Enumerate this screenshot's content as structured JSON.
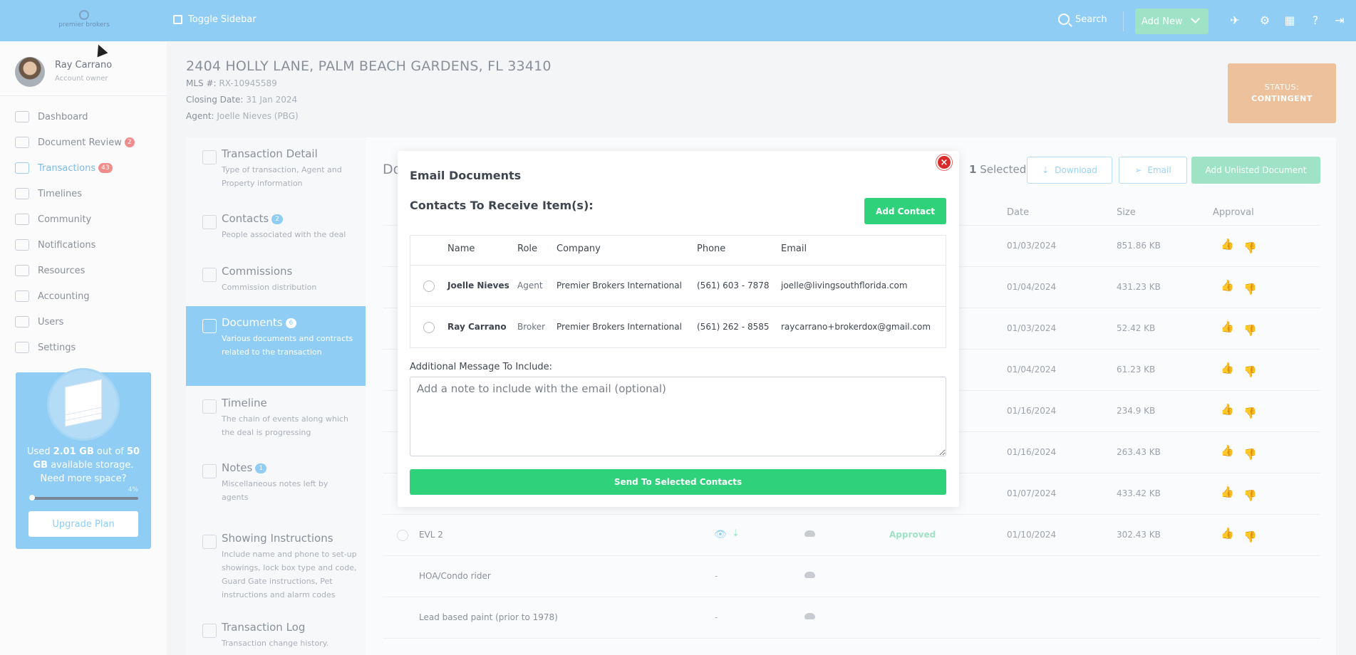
{
  "topbar": {
    "logo_text": "premier brokers",
    "toggle_label": "Toggle Sidebar",
    "search_label": "Search",
    "add_new_label": "Add New"
  },
  "user": {
    "name": "Ray Carrano",
    "role": "Account owner"
  },
  "sidebar": {
    "items": [
      {
        "label": "Dashboard",
        "icon": "dashboard-icon"
      },
      {
        "label": "Document Review",
        "badge": "2",
        "icon": "document-review-icon"
      },
      {
        "label": "Transactions",
        "badge": "43",
        "icon": "transactions-icon",
        "active": true
      },
      {
        "label": "Timelines",
        "icon": "timelines-icon"
      },
      {
        "label": "Community",
        "icon": "community-icon"
      },
      {
        "label": "Notifications",
        "icon": "notifications-icon"
      },
      {
        "label": "Resources",
        "icon": "resources-icon"
      },
      {
        "label": "Accounting",
        "icon": "accounting-icon"
      },
      {
        "label": "Users",
        "icon": "users-icon"
      },
      {
        "label": "Settings",
        "icon": "settings-icon"
      }
    ]
  },
  "storage": {
    "used_prefix": "Used ",
    "used": "2.01 GB",
    "mid": " out of ",
    "total": "50 GB",
    "suffix": " available storage.",
    "question": "Need more space?",
    "percent_label": "4%",
    "percent_value": 4,
    "upgrade_label": "Upgrade Plan"
  },
  "transaction": {
    "address": "2404 HOLLY LANE, PALM BEACH GARDENS, FL 33410",
    "mls_label": "MLS #:",
    "mls": "RX-10945589",
    "closing_label": "Closing Date:",
    "closing": "31 Jan 2024",
    "agent_label": "Agent:",
    "agent": "Joelle Nieves (PBG)",
    "status_label": "STATUS:",
    "status": "CONTINGENT"
  },
  "tabs": [
    {
      "title": "Transaction Detail",
      "desc": "Type of transaction, Agent and Property information"
    },
    {
      "title": "Contacts",
      "badge": "2",
      "desc": "People associated with the deal"
    },
    {
      "title": "Commissions",
      "desc": "Commission distribution"
    },
    {
      "title": "Documents",
      "badge": "6",
      "desc": "Various documents and contracts related to the transaction"
    },
    {
      "title": "Timeline",
      "desc": "The chain of events along which the deal is progressing"
    },
    {
      "title": "Notes",
      "badge": "1",
      "desc": "Miscellaneous notes left by agents"
    },
    {
      "title": "Showing Instructions",
      "desc": "Include name and phone to set-up showings, lock box type and code, Guard Gate instructions, Pet instructions and alarm codes"
    },
    {
      "title": "Transaction Log",
      "desc": "Transaction change history."
    }
  ],
  "documents": {
    "title_partial": "Do",
    "selected_count": "1",
    "selected_label": "Selected",
    "download_label": "Download",
    "email_label": "Email",
    "add_unlisted_label": "Add Unlisted Document",
    "columns": {
      "date": "Date",
      "size": "Size",
      "approval": "Approval"
    },
    "rows": [
      {
        "date": "01/03/2024",
        "size": "851.86 KB"
      },
      {
        "date": "01/04/2024",
        "size": "431.23 KB"
      },
      {
        "date": "01/03/2024",
        "size": "52.42 KB"
      },
      {
        "date": "01/04/2024",
        "size": "61.23 KB"
      },
      {
        "date": "01/16/2024",
        "size": "234.9 KB"
      },
      {
        "date": "01/16/2024",
        "size": "263.43 KB"
      },
      {
        "date": "01/07/2024",
        "size": "433.42 KB"
      },
      {
        "name": "EVL 2",
        "status": "Approved",
        "date": "01/10/2024",
        "size": "302.43 KB"
      },
      {
        "name": "HOA/Condo rider",
        "dash": "-"
      },
      {
        "name": "Lead based paint (prior to 1978)",
        "dash": "-"
      }
    ]
  },
  "modal": {
    "title": "Email Documents",
    "subtitle": "Contacts To Receive Item(s):",
    "add_contact_label": "Add Contact",
    "columns": {
      "name": "Name",
      "role": "Role",
      "company": "Company",
      "phone": "Phone",
      "email": "Email"
    },
    "contacts": [
      {
        "name": "Joelle Nieves",
        "role": "Agent",
        "company": "Premier Brokers International",
        "phone": "(561) 603 - 7878",
        "email": "joelle@livingsouthflorida.com"
      },
      {
        "name": "Ray Carrano",
        "role": "Broker",
        "company": "Premier Brokers International",
        "phone": "(561) 262 - 8585",
        "email": "raycarrano+brokerdox@gmail.com"
      }
    ],
    "message_label": "Additional Message To Include:",
    "message_placeholder": "Add a note to include with the email (optional)",
    "message_value": "",
    "send_label": "Send To Selected Contacts",
    "close_glyph": "×"
  }
}
